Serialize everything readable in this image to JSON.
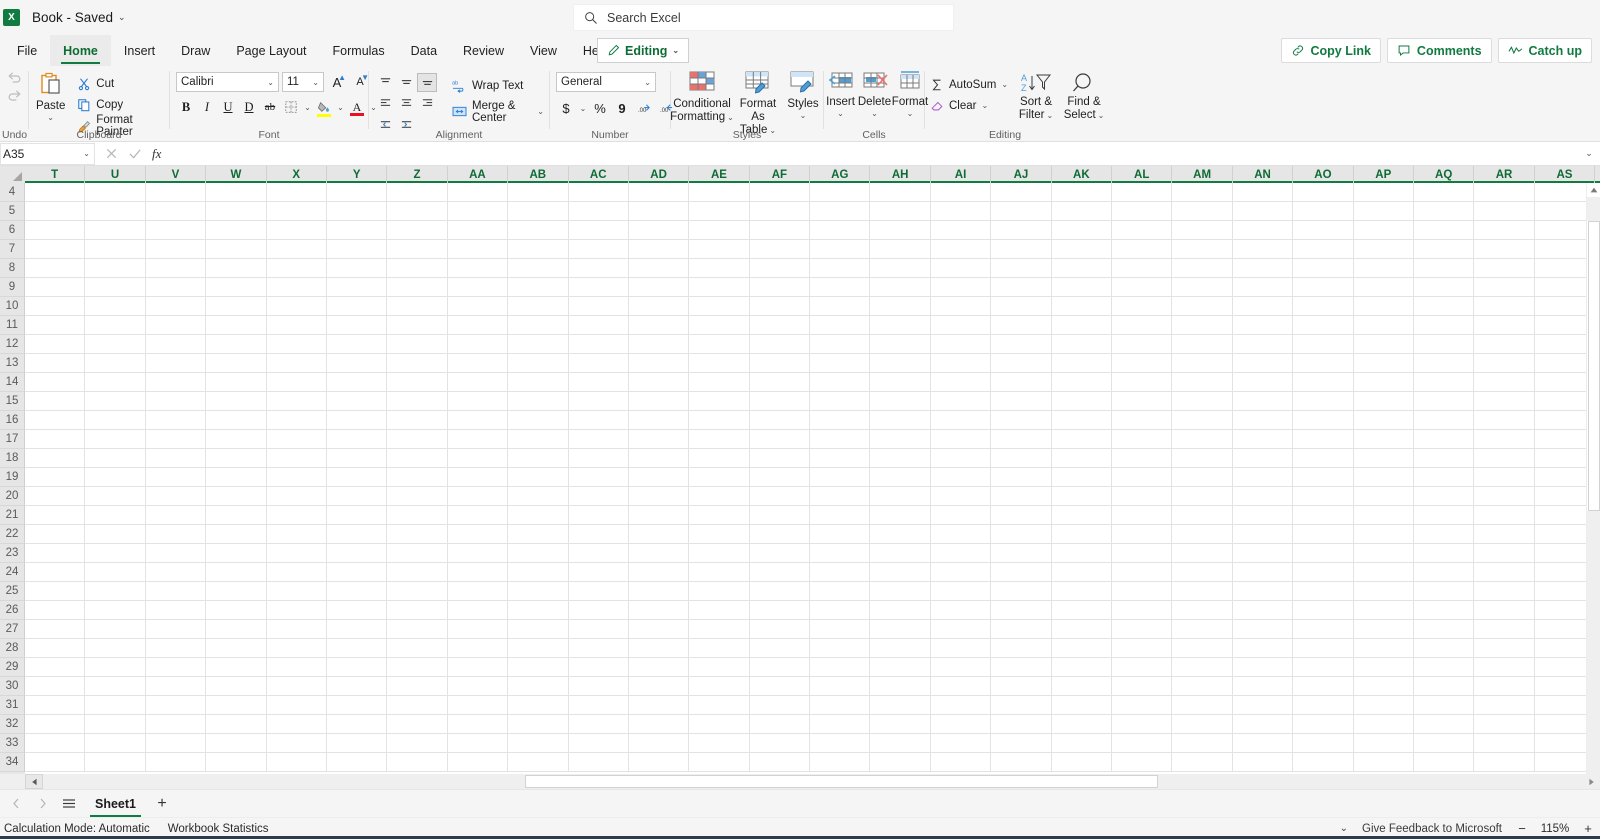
{
  "titlebar": {
    "logo_text": "X",
    "doc_title": "Book  -  Saved",
    "caret": "⌄"
  },
  "search": {
    "placeholder": "Search Excel",
    "icon": "search-icon"
  },
  "tabs": [
    {
      "label": "File",
      "active": false
    },
    {
      "label": "Home",
      "active": true
    },
    {
      "label": "Insert",
      "active": false
    },
    {
      "label": "Draw",
      "active": false
    },
    {
      "label": "Page Layout",
      "active": false
    },
    {
      "label": "Formulas",
      "active": false
    },
    {
      "label": "Data",
      "active": false
    },
    {
      "label": "Review",
      "active": false
    },
    {
      "label": "View",
      "active": false
    },
    {
      "label": "Help",
      "active": false
    }
  ],
  "editing_mode": {
    "label": "Editing",
    "caret": "⌄"
  },
  "top_right_buttons": [
    {
      "label": "Copy Link",
      "icon": "link-icon"
    },
    {
      "label": "Comments",
      "icon": "comment-icon"
    },
    {
      "label": "Catch up",
      "icon": "catchup-icon"
    }
  ],
  "ribbon": {
    "undo": {
      "group_label": "Undo",
      "undo_icon": "undo-arrow-icon",
      "redo_icon": "redo-arrow-icon"
    },
    "clipboard": {
      "group_label": "Clipboard",
      "paste": {
        "label": "Paste",
        "caret": "⌄"
      },
      "cut": "Cut",
      "copy": "Copy",
      "format_painter": "Format Painter"
    },
    "font": {
      "group_label": "Font",
      "font_name": "Calibri",
      "font_size": "11",
      "grow_font": "A",
      "shrink_font": "A",
      "bold": "B",
      "italic": "I",
      "underline": "U",
      "double_underline": "D",
      "strikethrough": "ab",
      "borders": "borders-icon",
      "fill_color": "fill-color-icon",
      "font_color": "A"
    },
    "alignment": {
      "group_label": "Alignment",
      "wrap_text": "Wrap Text",
      "merge_center": "Merge & Center",
      "merge_caret": "⌄"
    },
    "number": {
      "group_label": "Number",
      "format": "General",
      "currency": "$",
      "percent": "%",
      "comma": "9",
      "increase_decimal": "increase-decimal-icon",
      "decrease_decimal": "decrease-decimal-icon"
    },
    "styles": {
      "group_label": "Styles",
      "conditional_formatting": "Conditional\nFormatting",
      "conditional_formatting_l1": "Conditional",
      "conditional_formatting_l2": "Formatting",
      "format_as_table_l1": "Format As",
      "format_as_table_l2": "Table",
      "cell_styles": "Styles",
      "caret": "⌄"
    },
    "cells": {
      "group_label": "Cells",
      "insert": "Insert",
      "delete": "Delete",
      "format": "Format",
      "caret": "⌄"
    },
    "editing": {
      "group_label": "Editing",
      "autosum": "AutoSum",
      "clear": "Clear",
      "sort_filter_l1": "Sort &",
      "sort_filter_l2": "Filter",
      "find_select_l1": "Find &",
      "find_select_l2": "Select",
      "caret": "⌄"
    }
  },
  "formula_bar": {
    "name_box": "A35",
    "name_caret": "⌄",
    "cancel_icon": "cancel-x-icon",
    "enter_icon": "enter-check-icon",
    "fx": "fx",
    "formula_value": "",
    "expand_caret": "⌄"
  },
  "grid": {
    "columns": [
      "T",
      "U",
      "V",
      "W",
      "X",
      "Y",
      "Z",
      "AA",
      "AB",
      "AC",
      "AD",
      "AE",
      "AF",
      "AG",
      "AH",
      "AI",
      "AJ",
      "AK",
      "AL",
      "AM",
      "AN",
      "AO",
      "AP",
      "AQ",
      "AR",
      "AS"
    ],
    "rows": [
      4,
      5,
      6,
      7,
      8,
      9,
      10,
      11,
      12,
      13,
      14,
      15,
      16,
      17,
      18,
      19,
      20,
      21,
      22,
      23,
      24,
      25,
      26,
      27,
      28,
      29,
      30,
      31,
      32,
      33,
      34
    ],
    "active_cell": "A35",
    "header_color": "#107c41"
  },
  "sheet_bar": {
    "prev_icon": "chevron-left-icon",
    "next_icon": "chevron-right-icon",
    "all_sheets_icon": "hamburger-icon",
    "tabs": [
      {
        "label": "Sheet1",
        "active": true
      }
    ],
    "add_sheet": "+"
  },
  "status_bar": {
    "calculation_mode": "Calculation Mode: Automatic",
    "workbook_statistics": "Workbook Statistics",
    "overflow_caret": "⌄",
    "feedback": "Give Feedback to Microsoft",
    "zoom_out": "−",
    "zoom_level": "115%",
    "zoom_in": "+"
  },
  "colors": {
    "excel_green": "#107c41",
    "ribbon_bg": "#f5f5f5",
    "header_bg": "#e6e6e6",
    "grid_line": "#e3e3e3"
  }
}
